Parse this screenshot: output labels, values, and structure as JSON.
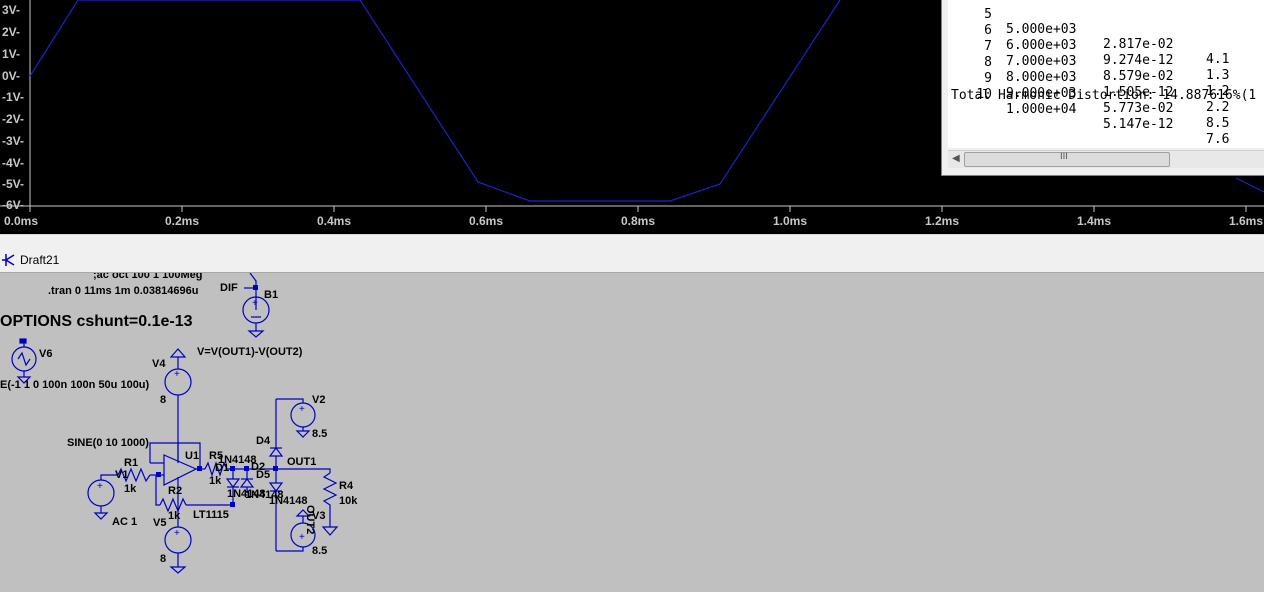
{
  "plot": {
    "y_ticks": [
      "3V-",
      "2V-",
      "1V-",
      "0V-",
      "-1V-",
      "-2V-",
      "-3V-",
      "-4V-",
      "-5V-",
      "-6V-"
    ],
    "x_ticks": [
      "0.0ms",
      "0.2ms",
      "0.4ms",
      "0.6ms",
      "0.8ms",
      "1.0ms",
      "1.2ms",
      "1.4ms",
      "1.6ms"
    ],
    "trace_color": "#2020c8",
    "background": "#000000"
  },
  "tab": {
    "title": "Draft21"
  },
  "schematic": {
    "directive_ac": ";ac oct 100 1 100Meg",
    "directive_tran": ".tran 0 11ms 1m 0.03814696u",
    "directive_options": "OPTIONS cshunt=0.1e-13",
    "b1_expr": "V=V(OUT1)-V(OUT2)",
    "net_dif": "DIF",
    "b1_name": "B1",
    "v6_name": "V6",
    "v6_value": "E(-1 1 0 100n 100n 50u 100u)",
    "v4_name": "V4",
    "v4_value": "8",
    "v1_name": "V1",
    "v1_value": "SINE(0 10 1000)",
    "v1_ac": "AC 1",
    "r1_name": "R1",
    "r1_value": "1k",
    "r2_name": "R2",
    "r2_value": "1k",
    "u1_name": "U1",
    "u1_model": "LT1115",
    "v5_name": "V5",
    "v5_value": "8",
    "r5_name": "R5",
    "r5_value": "1k",
    "d1_name": "D1",
    "d2_name": "D2",
    "d4_name": "D4",
    "d5_name": "D5",
    "diode_model": "1N4148",
    "net_out1": "OUT1",
    "net_out2": "OUT2",
    "r4_name": "R4",
    "r4_value": "10k",
    "v2_name": "V2",
    "v2_value": "8.5",
    "v3_name": "V3",
    "v3_value": "8.5",
    "wire_color": "#0000c0"
  },
  "log": {
    "rows": [
      {
        "n": "5",
        "freq": "5.000e+03",
        "comp": "2.817e-02",
        "norm": "4.1"
      },
      {
        "n": "6",
        "freq": "6.000e+03",
        "comp": "9.274e-12",
        "norm": "1.3"
      },
      {
        "n": "7",
        "freq": "7.000e+03",
        "comp": "8.579e-02",
        "norm": "1.2"
      },
      {
        "n": "8",
        "freq": "8.000e+03",
        "comp": "1.505e-12",
        "norm": "2.2"
      },
      {
        "n": "9",
        "freq": "9.000e+03",
        "comp": "5.773e-02",
        "norm": "8.5"
      },
      {
        "n": "10",
        "freq": "1.000e+04",
        "comp": "5.147e-12",
        "norm": "7.6"
      }
    ],
    "thd": "Total Harmonic Distortion: 14.887616%(1",
    "scroll_left": "◀",
    "scroll_grip": "III"
  }
}
